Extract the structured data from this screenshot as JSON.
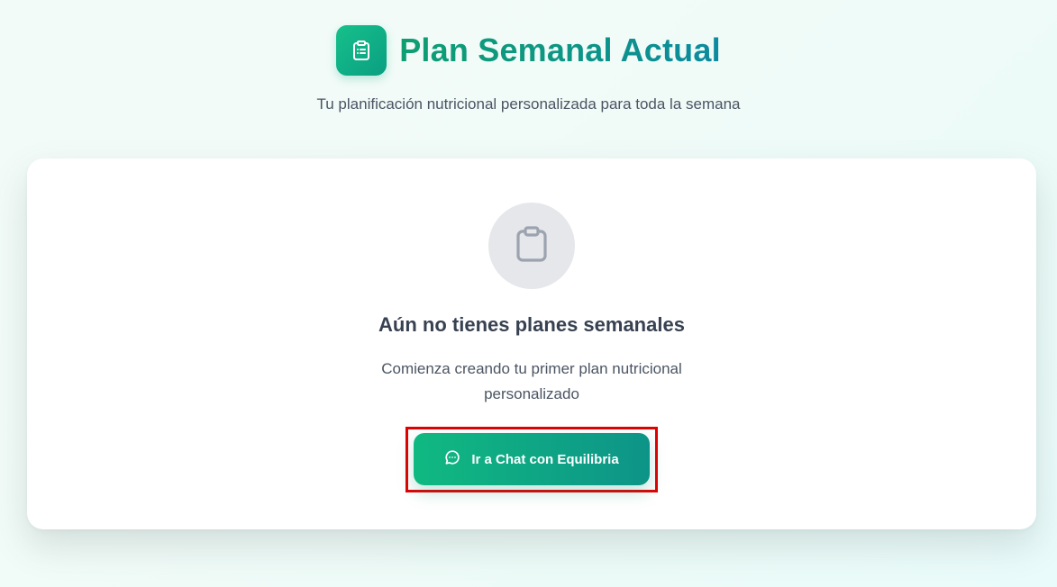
{
  "header": {
    "icon": "clipboard-list-icon",
    "title": "Plan Semanal Actual",
    "subtitle": "Tu planificación nutricional personalizada para toda la semana"
  },
  "empty_state": {
    "icon": "clipboard-icon",
    "title": "Aún no tienes planes semanales",
    "description": "Comienza creando tu primer plan nutricional personalizado",
    "button_icon": "chat-bubble-icon",
    "button_label": "Ir a Chat con Equilibria"
  },
  "colors": {
    "accent_start": "#10b981",
    "accent_end": "#0d9488",
    "highlight": "#e00000"
  }
}
